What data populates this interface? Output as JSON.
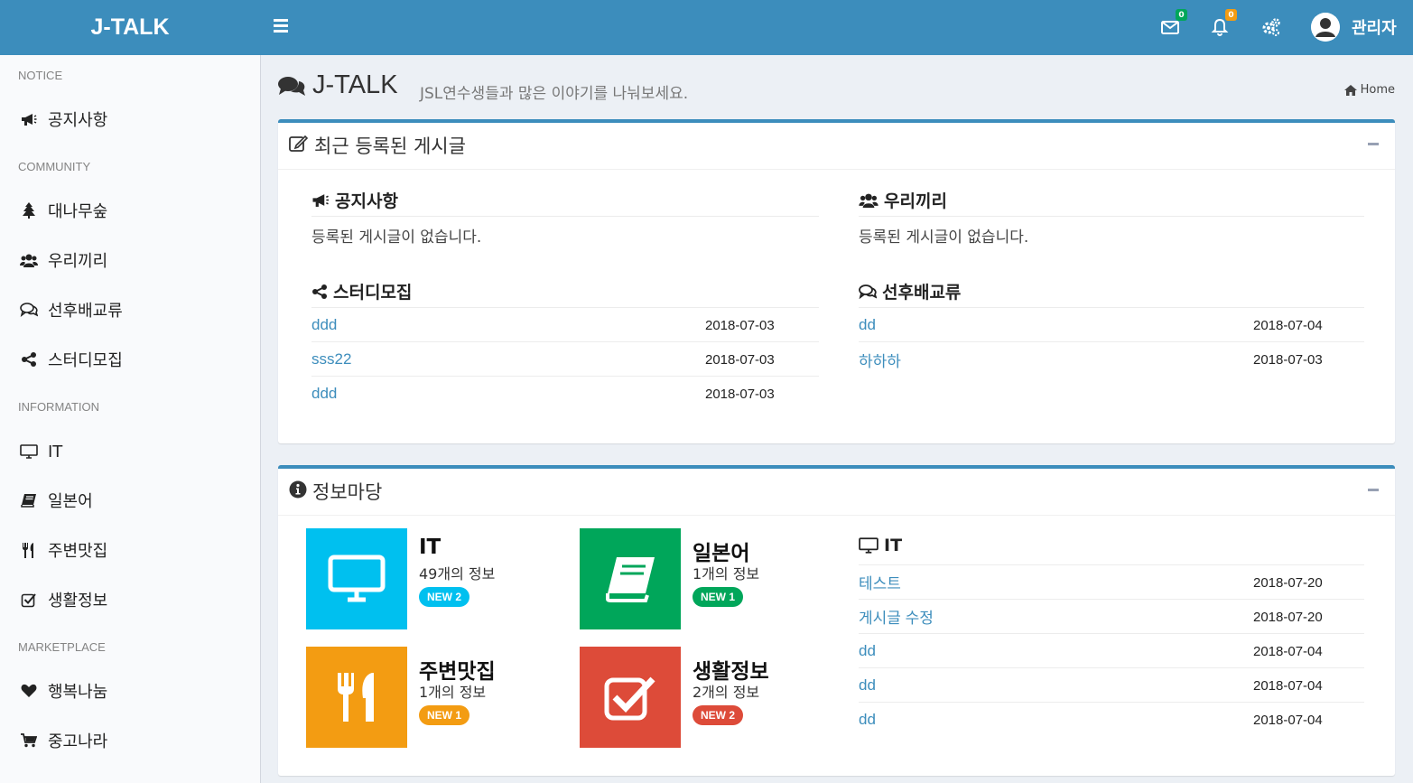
{
  "app": {
    "logo": "J-TALK",
    "username": "관리자"
  },
  "header_badges": {
    "mail": "0",
    "bell": "0"
  },
  "colors": {
    "primary": "#3c8dbc",
    "aqua": "#00c0ef",
    "green": "#00a65a",
    "orange": "#f39c12",
    "red": "#dd4b39"
  },
  "sidebar": {
    "headers": [
      "NOTICE",
      "COMMUNITY",
      "INFORMATION",
      "MARKETPLACE"
    ],
    "items": [
      {
        "label": "공지사항",
        "icon": "bullhorn-icon"
      },
      {
        "label": "대나무숲",
        "icon": "tree-icon"
      },
      {
        "label": "우리끼리",
        "icon": "users-icon"
      },
      {
        "label": "선후배교류",
        "icon": "comments-icon"
      },
      {
        "label": "스터디모집",
        "icon": "share-icon"
      },
      {
        "label": "IT",
        "icon": "desktop-icon"
      },
      {
        "label": "일본어",
        "icon": "book-icon"
      },
      {
        "label": "주변맛집",
        "icon": "cutlery-icon"
      },
      {
        "label": "생활정보",
        "icon": "check-square-icon"
      },
      {
        "label": "행복나눔",
        "icon": "heart-icon"
      },
      {
        "label": "중고나라",
        "icon": "cart-icon"
      }
    ]
  },
  "page": {
    "title": "J-TALK",
    "subtitle": "JSL연수생들과 많은 이야기를 나눠보세요.",
    "breadcrumb": "Home"
  },
  "recent": {
    "title": "최근 등록된 게시글",
    "notice": {
      "title": "공지사항",
      "empty": "등록된 게시글이 없습니다."
    },
    "together": {
      "title": "우리끼리",
      "empty": "등록된 게시글이 없습니다."
    },
    "study": {
      "title": "스터디모집",
      "posts": [
        {
          "title": "ddd",
          "date": "2018-07-03"
        },
        {
          "title": "sss22",
          "date": "2018-07-03"
        },
        {
          "title": "ddd",
          "date": "2018-07-03"
        }
      ]
    },
    "mentor": {
      "title": "선후배교류",
      "posts": [
        {
          "title": "dd",
          "date": "2018-07-04"
        },
        {
          "title": "하하하",
          "date": "2018-07-03"
        }
      ]
    }
  },
  "info": {
    "title": "정보마당",
    "tiles": [
      {
        "name": "IT",
        "count": "49개의 정보",
        "badge": "NEW 2",
        "icon": "desktop-icon"
      },
      {
        "name": "일본어",
        "count": "1개의 정보",
        "badge": "NEW 1",
        "icon": "book-icon"
      },
      {
        "name": "주변맛집",
        "count": "1개의 정보",
        "badge": "NEW 1",
        "icon": "cutlery-icon"
      },
      {
        "name": "생활정보",
        "count": "2개의 정보",
        "badge": "NEW 2",
        "icon": "check-square-icon"
      }
    ],
    "it": {
      "title": "IT",
      "posts": [
        {
          "title": "테스트",
          "date": "2018-07-20"
        },
        {
          "title": "게시글 수정",
          "date": "2018-07-20"
        },
        {
          "title": "dd",
          "date": "2018-07-04"
        },
        {
          "title": "dd",
          "date": "2018-07-04"
        },
        {
          "title": "dd",
          "date": "2018-07-04"
        }
      ]
    }
  }
}
